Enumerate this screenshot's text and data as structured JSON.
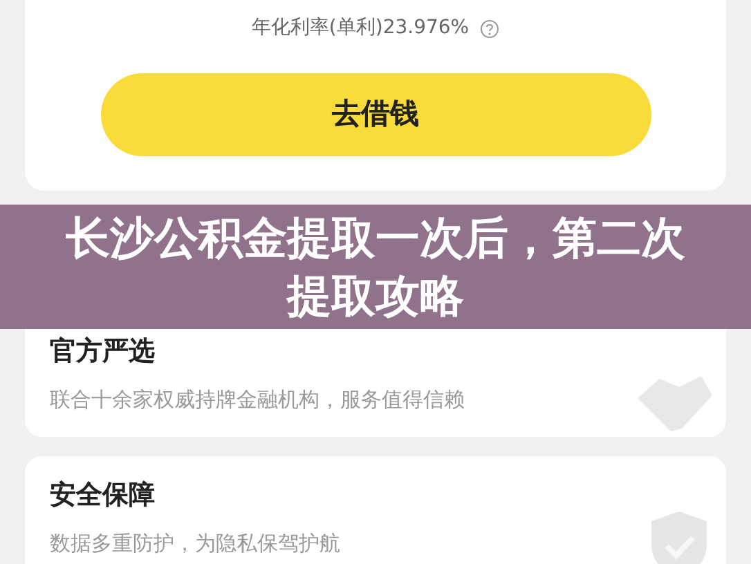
{
  "loan_card": {
    "rate_text": "年化利率(单利)23.976%",
    "button": "去借钱"
  },
  "features": [
    {
      "title": "官方严选",
      "description": "联合十余家权威持牌金融机构，服务值得信赖",
      "kind": "partners"
    },
    {
      "title": "安全保障",
      "description": "数据多重防护，为隐私保驾护航",
      "kind": "shield"
    }
  ],
  "banner": {
    "title": "长沙公积金提取一次后，第二次提取攻略"
  }
}
